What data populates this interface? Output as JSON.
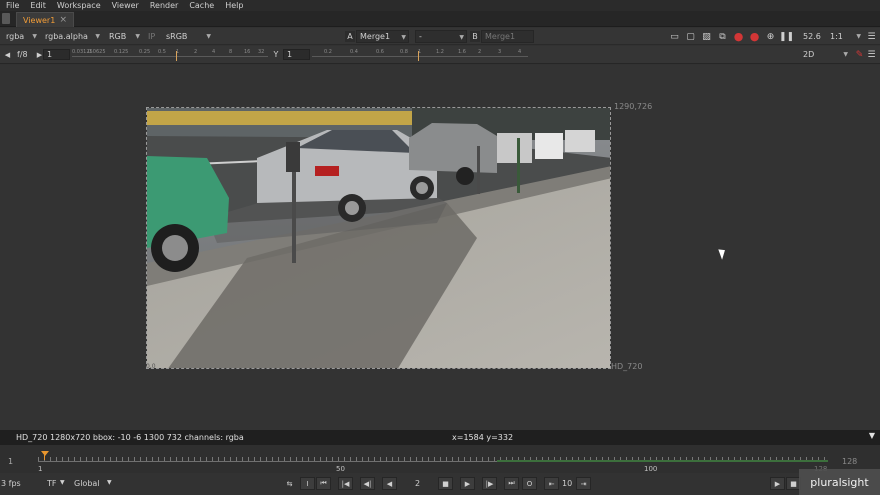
{
  "menu": [
    "File",
    "Edit",
    "Workspace",
    "Viewer",
    "Render",
    "Cache",
    "Help"
  ],
  "tab": {
    "label": "Viewer1",
    "close": "×"
  },
  "toolbar1": {
    "layer": "rgba",
    "alpha": "rgba.alpha",
    "display": "RGB",
    "ip": "IP",
    "lut": "sRGB",
    "a_label": "A",
    "a_input": "Merge1",
    "op": "-",
    "b_label": "B",
    "b_input": "Merge1",
    "zoom": "52.6",
    "ratio": "1:1"
  },
  "toolbar2": {
    "fstop": "f/8",
    "gain_value": "1",
    "gain_ticks": [
      "0.03125",
      "0.0625",
      "0.125",
      "0.25",
      "0.5",
      "1",
      "2",
      "4",
      "8",
      "16",
      "32"
    ],
    "y_label": "Y",
    "gamma_value": "1",
    "gamma_ticks": [
      "0.2",
      "0.4",
      "0.6",
      "0.8",
      "1",
      "1.2",
      "1.6",
      "2",
      "3",
      "4"
    ],
    "view_mode": "2D"
  },
  "viewer": {
    "top_right_label": "1290,726",
    "format_label": "HD_720",
    "bottom_left_label": "0,0"
  },
  "info": {
    "left": "HD_720 1280x720  bbox: -10 -6 1300 732 channels: rgba",
    "cursor": "x=1584 y=332"
  },
  "timeline": {
    "start": "1",
    "end": "128",
    "labels": [
      "1",
      "50",
      "100",
      "128"
    ],
    "current_frame": 1
  },
  "transport": {
    "fps": "3 fps",
    "tf": "TF",
    "range": "Global",
    "frame": "2",
    "increment": "10"
  },
  "logo": "pluralsight",
  "colors": {
    "accent": "#f29d38",
    "record": "#d23636",
    "cached": "#3c6f3c"
  }
}
